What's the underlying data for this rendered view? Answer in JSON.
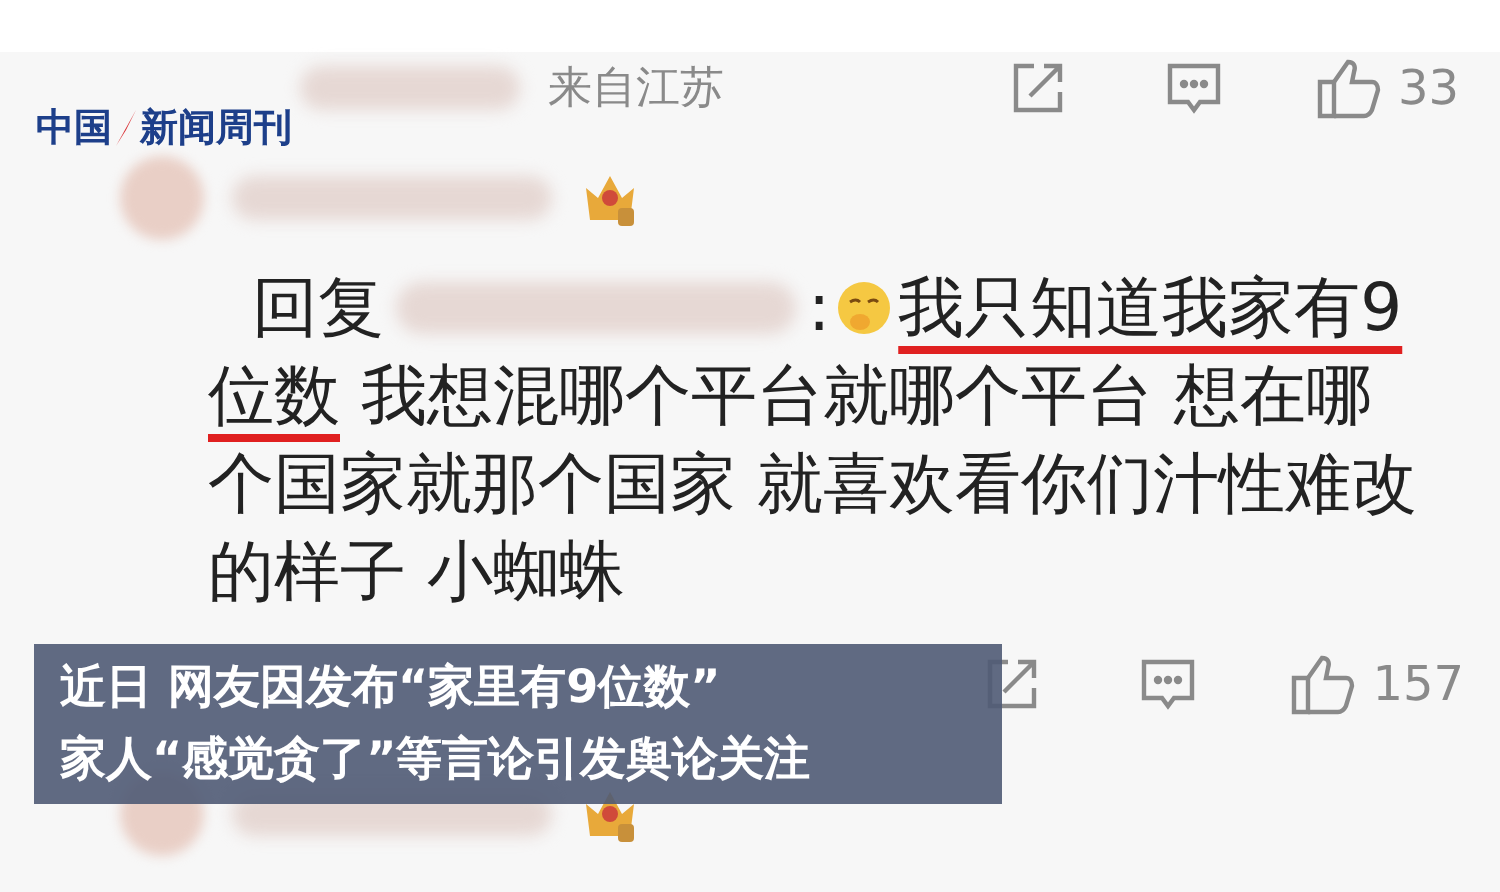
{
  "logo": {
    "left": "中国",
    "right": "新闻周刊"
  },
  "comment_header": {
    "location": "来自江苏",
    "likes": "33"
  },
  "reply": {
    "prefix": "回复",
    "separator": ":",
    "lines": [
      [
        {
          "text": "我只知道我家有9",
          "underlined": true
        }
      ],
      [
        {
          "text": "位数",
          "underlined": true
        },
        {
          "text": " 我想混哪个平台就哪个平台 想在哪",
          "underlined": false
        }
      ],
      [
        {
          "text": "个国家就那个国家 就喜欢看你们汁性难改",
          "underlined": false
        }
      ],
      [
        {
          "text": "的样子 小蜘蛛",
          "underlined": false
        }
      ]
    ]
  },
  "reply_actions": {
    "likes": "157"
  },
  "caption": {
    "lines": [
      "近日 网友因发布“家里有9位数”",
      "家人“感觉贪了”等言论引发舆论关注"
    ]
  }
}
